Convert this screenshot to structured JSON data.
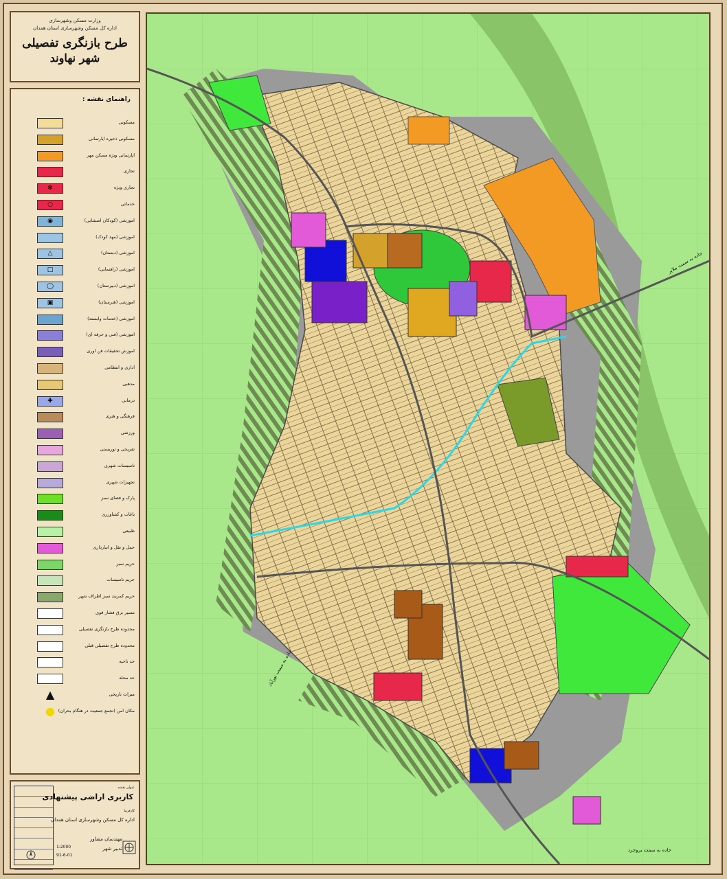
{
  "header": {
    "ministry": "وزارت مسکن وشهرسازی",
    "office": "اداره کل مسکن وشهرسازی استان همدان",
    "plan_title": "طرح بازنگری تفصیلی",
    "city_name": "شهر نهاوند"
  },
  "legend": {
    "title": "راهنمای نقشه :",
    "items": [
      {
        "label": "مسکونی",
        "color": "#f2dc98",
        "mark": ""
      },
      {
        "label": "مسکونی ذخیره ایارتمانی",
        "color": "#d4a22a",
        "mark": ""
      },
      {
        "label": "اپارتمانی ویژه مسکن مهر",
        "color": "#f39a25",
        "mark": ""
      },
      {
        "label": "تجاری",
        "color": "#e8284a",
        "mark": ""
      },
      {
        "label": "تجاری ویژه",
        "color": "#e8284a",
        "mark": "✻"
      },
      {
        "label": "خدماتی",
        "color": "#e8284a",
        "mark": "○"
      },
      {
        "label": "اموزشی (کودکان استثنایی)",
        "color": "#7fb3d8",
        "mark": "◉"
      },
      {
        "label": "اموزشی (مهد کودک)",
        "color": "#9ec4e4",
        "mark": ""
      },
      {
        "label": "اموزشی (دبستان)",
        "color": "#9ec4e4",
        "mark": "△"
      },
      {
        "label": "اموزشی (راهنمایی)",
        "color": "#9ec4e4",
        "mark": "□"
      },
      {
        "label": "اموزشی (دبیرستان)",
        "color": "#9ec4e4",
        "mark": "◯"
      },
      {
        "label": "اموزشی (هنرستان)",
        "color": "#9ec4e4",
        "mark": "▣"
      },
      {
        "label": "اموزشی (خدمات وابسته)",
        "color": "#6aa5cf",
        "mark": ""
      },
      {
        "label": "اموزشی (فنی و حرفه ای)",
        "color": "#8a7fd6",
        "mark": ""
      },
      {
        "label": "اموزش تحقیقات فن اوری",
        "color": "#7a5fb8",
        "mark": ""
      },
      {
        "label": "اداری و انتظامی",
        "color": "#d8b37a",
        "mark": ""
      },
      {
        "label": "مذهبی",
        "color": "#e6c878",
        "mark": ""
      },
      {
        "label": "درمانی",
        "color": "#9aa8e8",
        "mark": "✚"
      },
      {
        "label": "فرهنگی و هنری",
        "color": "#b98a5a",
        "mark": ""
      },
      {
        "label": "ورزشی",
        "color": "#9b5fb5",
        "mark": ""
      },
      {
        "label": "تفریحی و توریستی",
        "color": "#e8a6dc",
        "mark": ""
      },
      {
        "label": "تاسیسات شهری",
        "color": "#c9a6d6",
        "mark": ""
      },
      {
        "label": "تجهیزات شهری",
        "color": "#b7a9d9",
        "mark": ""
      },
      {
        "label": "پارک و فضای سبز",
        "color": "#6fe02a",
        "mark": ""
      },
      {
        "label": "باغات و کشاورزی",
        "color": "#1a8a1a",
        "mark": ""
      },
      {
        "label": "طبیعی",
        "color": "#b9f0a8",
        "mark": ""
      },
      {
        "label": "حمل و نقل و انبارداری",
        "color": "#e35ad8",
        "mark": ""
      },
      {
        "label": "حریم سبز",
        "color": "#7ed66a",
        "mark": ""
      },
      {
        "label": "حریم تاسیسات",
        "color": "#c6e6b8",
        "mark": ""
      },
      {
        "label": "حریم کمربند سبز اطراف شهر",
        "color": "#8aa86a",
        "mark": ""
      },
      {
        "label": "مسیر برق فشار قوی",
        "color": "#ffffff",
        "mark": ""
      },
      {
        "label": "محدوده طرح بازنگری تفصیلی",
        "color": "#ffffff",
        "mark": ""
      },
      {
        "label": "محدوده طرح تفصیلی قبلی",
        "color": "#ffffff",
        "mark": ""
      },
      {
        "label": "حد ناحیه",
        "color": "#ffffff",
        "mark": ""
      },
      {
        "label": "حد محله",
        "color": "#ffffff",
        "mark": ""
      },
      {
        "label": "میراث تاریخی",
        "color": "none",
        "mark": "▲"
      },
      {
        "label": "مکان امن (تجمع جمعیت در هنگام بحران)",
        "color": "none",
        "mark": "●"
      }
    ]
  },
  "cartouche": {
    "drawing_title_label": "عنوان نقشه",
    "drawing_title": "کاربری اراضی پیشنهادی",
    "employer_label": "کارفرما",
    "employer": "اداره کل مسکن وشهرسازی استان همدان",
    "consultant": "مهندسان مشاور",
    "consultant_name": "تدبیر شهر",
    "scale": "1:2000",
    "date": "91-6-01"
  },
  "map": {
    "road_labels": [
      "جاده به سمت ملایر",
      "جاده به سمت نورآباد",
      "جاده به سمت بروجرد"
    ]
  }
}
